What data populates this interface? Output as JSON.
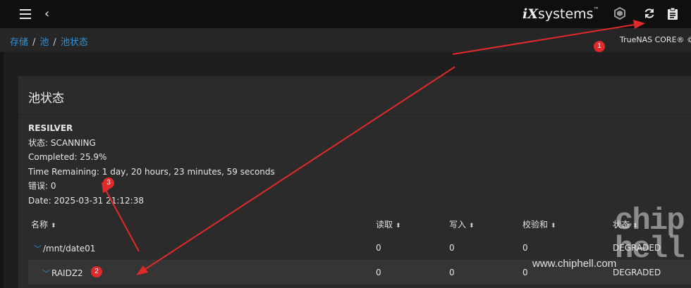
{
  "topbar": {
    "menu_icon": "hamburger-menu-icon",
    "back_icon": "chevron-left-icon",
    "logo_prefix": "iX",
    "logo_text": "systems",
    "logo_tm": "™",
    "icons": [
      "truecommand-icon",
      "refresh-icon",
      "clipboard-icon"
    ]
  },
  "breadcrumb": {
    "items": [
      "存储",
      "池",
      "池状态"
    ],
    "separator": "/"
  },
  "product_name": "TrueNAS CORE® ©",
  "card": {
    "title": "池状态"
  },
  "scan": {
    "header": "RESILVER",
    "state": "状态: SCANNING",
    "completed": "Completed: 25.9%",
    "time_remaining": "Time Remaining: 1 day, 20 hours, 23 minutes, 59 seconds",
    "errors": "错误: 0",
    "date": "Date: 2025-03-31 21:12:38"
  },
  "table": {
    "columns": [
      "名称",
      "读取",
      "写入",
      "校验和",
      "状态"
    ],
    "rows": [
      {
        "name": "/mnt/date01",
        "read": "0",
        "write": "0",
        "checksum": "0",
        "status": "DEGRADED"
      },
      {
        "name": "RAIDZ2",
        "read": "0",
        "write": "0",
        "checksum": "0",
        "status": "DEGRADED"
      }
    ]
  },
  "annotations": {
    "badges": [
      "1",
      "2",
      "3"
    ],
    "arrow_color": "#e22a2a"
  },
  "watermark": {
    "site": "www.chiphell.com",
    "logo": "chip hell"
  },
  "colors": {
    "accent": "#2f93d6",
    "topbar_bg": "#0f0f0f",
    "card_bg": "#2b2b2b"
  }
}
